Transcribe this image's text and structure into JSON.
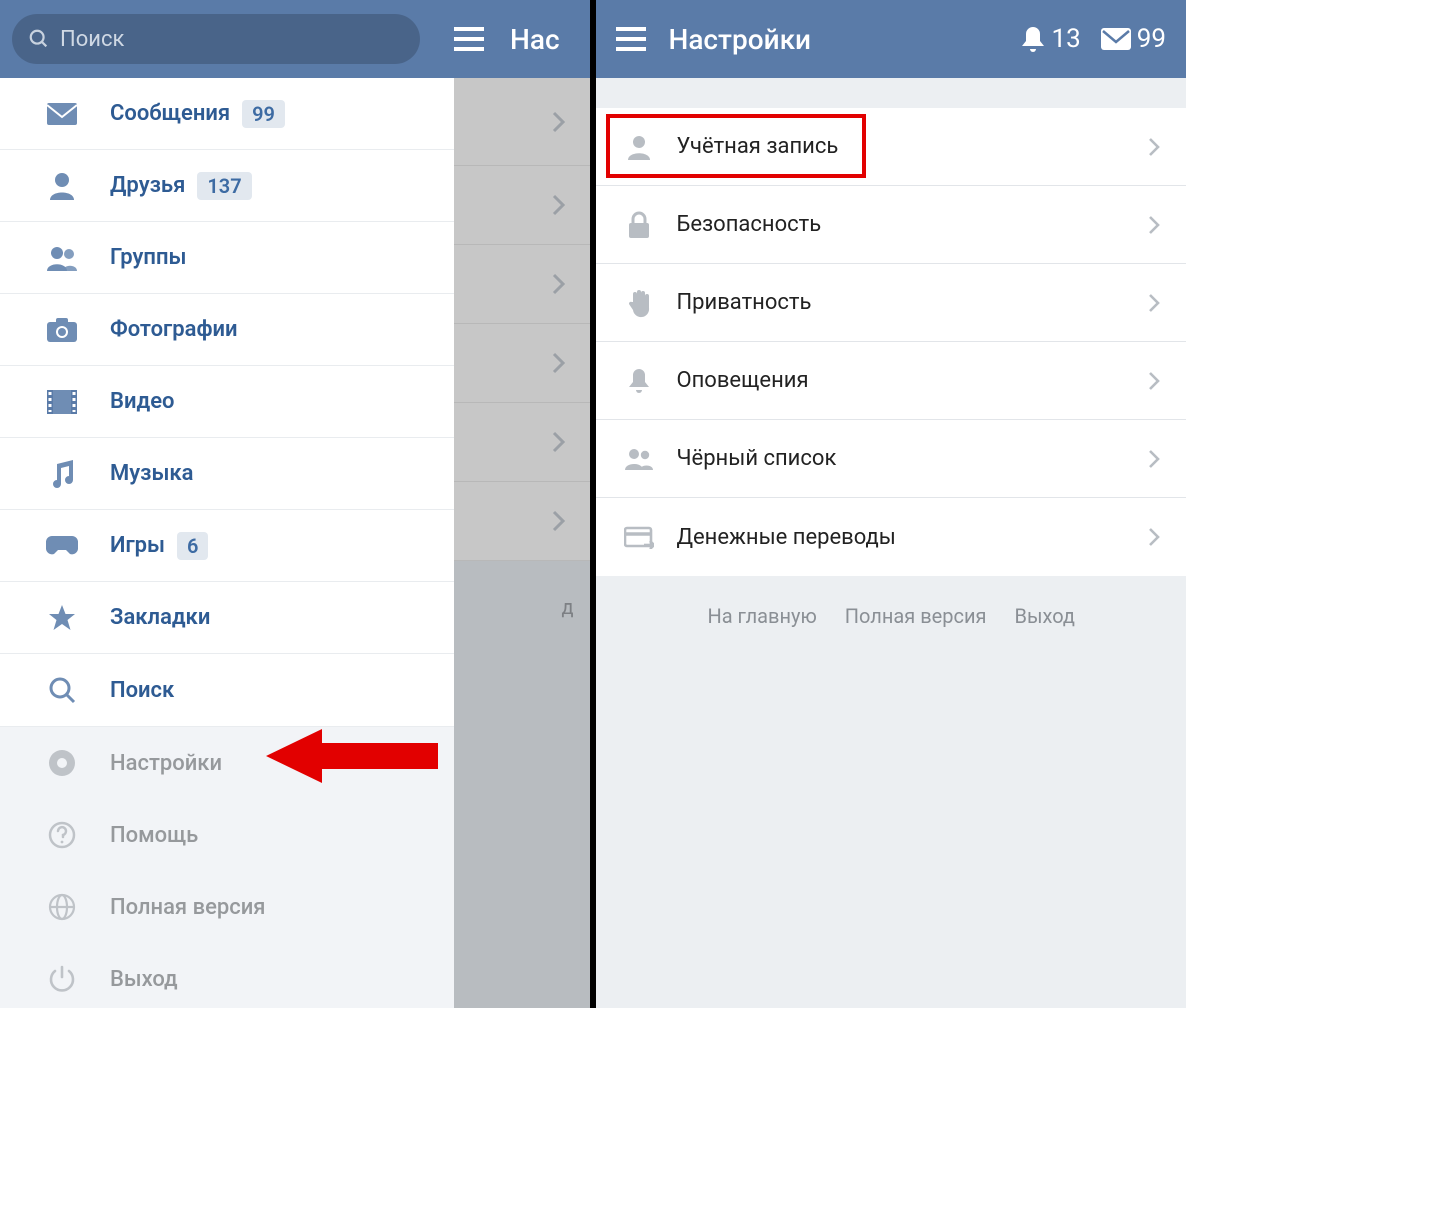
{
  "left": {
    "header": {
      "search_placeholder": "Поиск",
      "title_partial": "Нас"
    },
    "sidebar": {
      "items": [
        {
          "icon": "mail",
          "label": "Сообщения",
          "badge": "99"
        },
        {
          "icon": "friend",
          "label": "Друзья",
          "badge": "137"
        },
        {
          "icon": "groups",
          "label": "Группы",
          "badge": null
        },
        {
          "icon": "camera",
          "label": "Фотографии",
          "badge": null
        },
        {
          "icon": "video",
          "label": "Видео",
          "badge": null
        },
        {
          "icon": "music",
          "label": "Музыка",
          "badge": null
        },
        {
          "icon": "games",
          "label": "Игры",
          "badge": "6"
        },
        {
          "icon": "star",
          "label": "Закладки",
          "badge": null
        },
        {
          "icon": "search",
          "label": "Поиск",
          "badge": null
        }
      ],
      "secondary": [
        {
          "icon": "gear",
          "label": "Настройки"
        },
        {
          "icon": "help",
          "label": "Помощь"
        },
        {
          "icon": "globe",
          "label": "Полная версия"
        },
        {
          "icon": "power",
          "label": "Выход"
        }
      ]
    },
    "dim_footer_text": "д"
  },
  "right": {
    "header": {
      "title": "Настройки",
      "notifications": "13",
      "messages": "99"
    },
    "settings": [
      {
        "icon": "person",
        "label": "Учётная запись"
      },
      {
        "icon": "lock",
        "label": "Безопасность"
      },
      {
        "icon": "hand",
        "label": "Приватность"
      },
      {
        "icon": "bell",
        "label": "Оповещения"
      },
      {
        "icon": "people",
        "label": "Чёрный список"
      },
      {
        "icon": "card",
        "label": "Денежные переводы"
      }
    ],
    "footer": {
      "home": "На главную",
      "full": "Полная версия",
      "exit": "Выход"
    }
  }
}
